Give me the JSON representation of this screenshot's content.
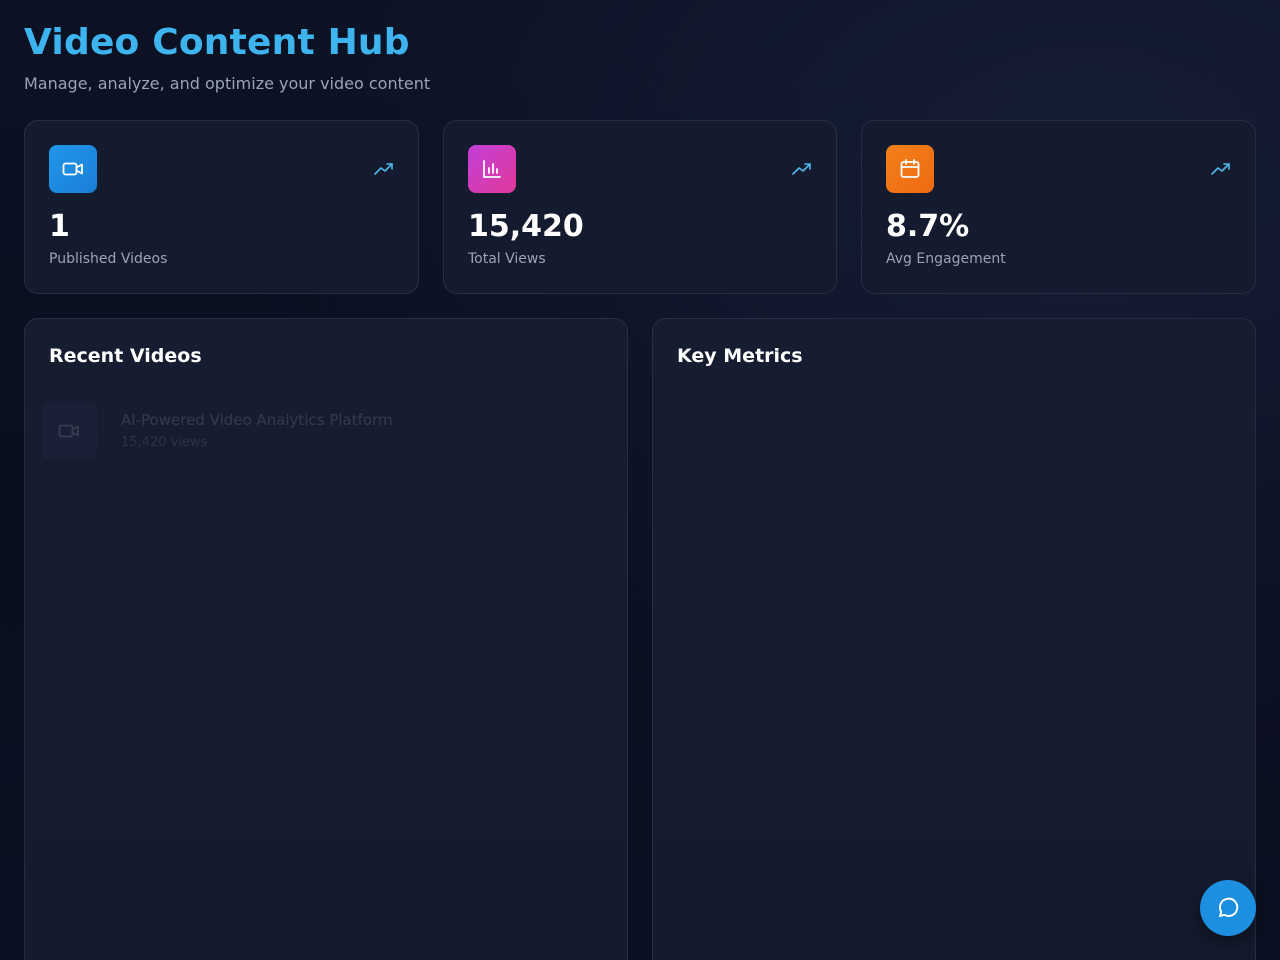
{
  "header": {
    "title": "Video Content Hub",
    "subtitle": "Manage, analyze, and optimize your video content"
  },
  "stats": [
    {
      "value": "1",
      "label": "Published Videos",
      "icon": "video-camera-icon",
      "accent": "#2196e8"
    },
    {
      "value": "15,420",
      "label": "Total Views",
      "icon": "bar-chart-icon",
      "accent": "#c23fd8"
    },
    {
      "value": "8.7%",
      "label": "Avg Engagement",
      "icon": "calendar-icon",
      "accent": "#f2801a"
    }
  ],
  "trend_icon": "trending-up-icon",
  "recent_videos": {
    "title": "Recent Videos",
    "items": [
      {
        "title": "AI-Powered Video Analytics Platform",
        "meta": "15,420 views"
      }
    ]
  },
  "key_metrics": {
    "title": "Key Metrics"
  },
  "colors": {
    "background": "#0a0f1f",
    "card": "#151b2e",
    "title": "#3db4ee",
    "chat_button": "#1d8fe0"
  }
}
